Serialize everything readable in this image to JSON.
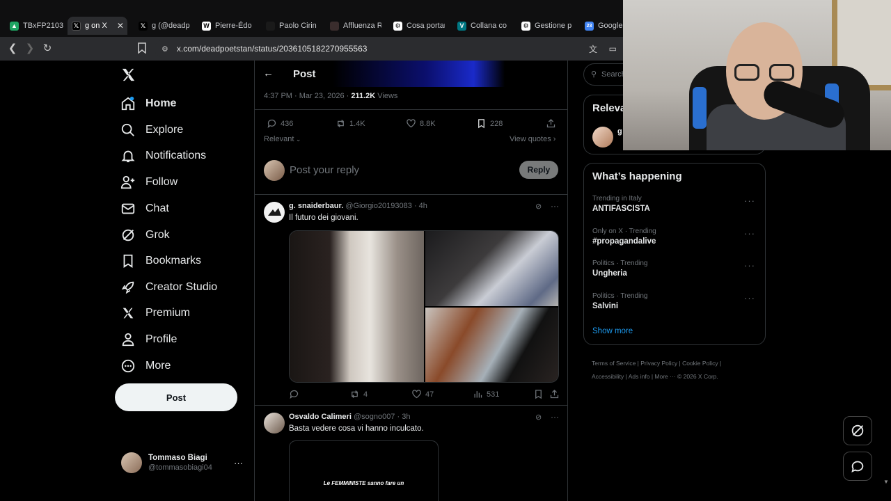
{
  "browser": {
    "tabs": [
      {
        "title": "TBxFP2103",
        "icon": "google-drive-icon",
        "color": "#1fa463"
      },
      {
        "title": "g on X",
        "icon": "x-logo-icon",
        "color": "#000000",
        "active": true
      },
      {
        "title": "g (@deadp",
        "icon": "x-logo-icon",
        "color": "#000000"
      },
      {
        "title": "Pierre-Édo",
        "icon": "wikipedia-icon",
        "color": "#ffffff"
      },
      {
        "title": "Paolo Cirin",
        "icon": "site-icon",
        "color": "#1a1a1a"
      },
      {
        "title": "Affluenza R",
        "icon": "site-icon",
        "color": "#3a2d2d"
      },
      {
        "title": "Cosa portar",
        "icon": "chatgpt-icon",
        "color": "#ffffff"
      },
      {
        "title": "Collana co",
        "icon": "vinted-icon",
        "color": "#007782"
      },
      {
        "title": "Gestione p",
        "icon": "chatgpt-icon",
        "color": "#ffffff"
      },
      {
        "title": "Google",
        "icon": "calendar-icon",
        "color": "#4285f4"
      }
    ],
    "url": "x.com/deadpoetstan/status/2036105182270955563"
  },
  "nav": {
    "items": [
      {
        "label": "Home",
        "icon": "home-icon"
      },
      {
        "label": "Explore",
        "icon": "search-icon"
      },
      {
        "label": "Notifications",
        "icon": "bell-icon"
      },
      {
        "label": "Follow",
        "icon": "follow-icon"
      },
      {
        "label": "Chat",
        "icon": "mail-icon"
      },
      {
        "label": "Grok",
        "icon": "grok-icon"
      },
      {
        "label": "Bookmarks",
        "icon": "bookmark-icon"
      },
      {
        "label": "Creator Studio",
        "icon": "rocket-icon"
      },
      {
        "label": "Premium",
        "icon": "x-logo-icon"
      },
      {
        "label": "Profile",
        "icon": "person-icon"
      },
      {
        "label": "More",
        "icon": "more-circle-icon"
      }
    ],
    "post_label": "Post",
    "account": {
      "name": "Tommaso Biagi",
      "handle": "@tommasobiagi04"
    }
  },
  "header": {
    "title": "Post"
  },
  "main_post": {
    "time": "4:37 PM · Mar 23, 2026 · ",
    "views_count": "211.2K",
    "views_label": " Views",
    "replies": "436",
    "reposts": "1.4K",
    "likes": "8.8K",
    "bookmarks": "228",
    "sort": "Relevant",
    "view_quotes": "View quotes"
  },
  "reply_box": {
    "placeholder": "Post your reply",
    "button": "Reply"
  },
  "replies": [
    {
      "name": "g. snaiderbaur.",
      "handle": "@Giorgio20193083",
      "time": "· 4h",
      "text": "Il futuro dei giovani.",
      "replies": "",
      "reposts": "4",
      "likes": "47",
      "views": "531"
    },
    {
      "name": "Osvaldo Calimeri",
      "handle": "@sogno007",
      "time": "· 3h",
      "text": "Basta vedere cosa vi hanno inculcato.",
      "image_text": "Le FEMMINISTE sanno fare un"
    }
  ],
  "right": {
    "search_placeholder": "Search",
    "relevant_title": "Relevant people",
    "relevant_person": "g",
    "happening_title": "What’s happening",
    "trends": [
      {
        "meta": "Trending in Italy",
        "name": "ANTIFASCISTA"
      },
      {
        "meta": "Only on X · Trending",
        "name": "#propagandalive"
      },
      {
        "meta": "Politics · Trending",
        "name": "Ungheria"
      },
      {
        "meta": "Politics · Trending",
        "name": "Salvini"
      }
    ],
    "show_more": "Show more",
    "footer": [
      "Terms of Service",
      "Privacy Policy",
      "Cookie Policy",
      "Accessibility",
      "Ads info",
      "More ···",
      "© 2026 X Corp."
    ]
  },
  "colors": {
    "accent": "#1d9bf0",
    "border": "#2f3336",
    "muted": "#71767b"
  }
}
